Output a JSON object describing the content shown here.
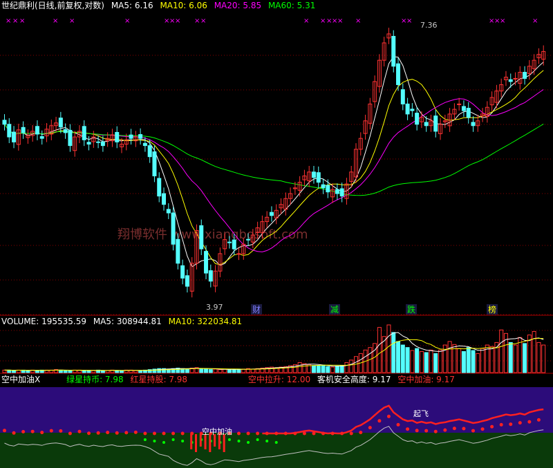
{
  "header": {
    "title": "世纪鼎利(日线,前复权,对数)",
    "ma5": "MA5: 6.16",
    "ma10": "MA10: 6.06",
    "ma20": "MA20: 5.85",
    "ma60": "MA60: 5.31"
  },
  "volume_header": {
    "label": "VOLUME: 195535.59",
    "ma5": "MA5: 308944.81",
    "ma10": "MA10: 322034.81"
  },
  "indicator_header": {
    "name": "空中加油X",
    "green": "绿星持币: 7.98",
    "red": "红星持股: 7.98",
    "pull": "空中拉升: 12.00",
    "safety": "客机安全高度: 9.17",
    "fuel": "空中加油: 9.17"
  },
  "annotations": {
    "high_label": "7.36",
    "low_label": "3.97",
    "badges": [
      "财",
      "减",
      "跌",
      "榜"
    ],
    "watermark": "翔博软件 www.xiangbosoft.com",
    "ind_label_1": "空中加油",
    "ind_label_2": "起飞"
  },
  "colors": {
    "up": "#ff3232",
    "down": "#54ffff",
    "ma5": "#ffffff",
    "ma10": "#ffff00",
    "ma20": "#ff00ff",
    "ma60": "#00ff00",
    "grid": "#8b0000",
    "ind_sky": "#2c0c7a",
    "ind_ground": "#0a3a0a"
  },
  "chart_data": {
    "type": "candlestick",
    "ylim_log": [
      3.8,
      7.6
    ],
    "closes": [
      5.9,
      5.72,
      5.65,
      5.82,
      5.78,
      5.74,
      5.8,
      5.76,
      5.7,
      5.83,
      5.88,
      5.92,
      5.86,
      5.78,
      5.6,
      5.72,
      5.8,
      5.68,
      5.62,
      5.72,
      5.65,
      5.6,
      5.7,
      5.75,
      5.65,
      5.62,
      5.68,
      5.7,
      5.72,
      5.7,
      5.6,
      5.45,
      5.2,
      4.95,
      4.85,
      4.75,
      4.4,
      4.2,
      4.05,
      3.97,
      4.2,
      4.55,
      4.35,
      4.1,
      4.02,
      4.12,
      4.3,
      4.45,
      4.42,
      4.35,
      4.3,
      4.4,
      4.45,
      4.5,
      4.58,
      4.65,
      4.7,
      4.72,
      4.78,
      4.85,
      4.92,
      4.98,
      5.05,
      5.12,
      5.2,
      5.25,
      5.18,
      5.12,
      5.05,
      5.0,
      5.03,
      4.98,
      4.95,
      5.1,
      5.25,
      5.55,
      5.7,
      5.95,
      6.2,
      6.55,
      6.9,
      7.2,
      7.36,
      6.8,
      6.5,
      6.2,
      6.05,
      6.1,
      5.9,
      6.0,
      5.88,
      5.95,
      5.8,
      5.9,
      5.95,
      6.05,
      6.12,
      6.2,
      6.1,
      6.0,
      5.88,
      5.95,
      6.05,
      6.15,
      6.3,
      6.4,
      6.5,
      6.62,
      6.55,
      6.6,
      6.7,
      6.6,
      6.8,
      6.9,
      7.0,
      7.05
    ],
    "volumes": [
      0.05,
      0.05,
      0.04,
      0.05,
      0.05,
      0.04,
      0.05,
      0.04,
      0.05,
      0.05,
      0.05,
      0.06,
      0.05,
      0.04,
      0.04,
      0.05,
      0.05,
      0.04,
      0.04,
      0.04,
      0.05,
      0.04,
      0.04,
      0.05,
      0.04,
      0.04,
      0.05,
      0.05,
      0.04,
      0.04,
      0.05,
      0.06,
      0.07,
      0.08,
      0.08,
      0.07,
      0.08,
      0.09,
      0.08,
      0.07,
      0.09,
      0.1,
      0.08,
      0.07,
      0.06,
      0.07,
      0.06,
      0.07,
      0.06,
      0.06,
      0.07,
      0.07,
      0.08,
      0.07,
      0.08,
      0.09,
      0.1,
      0.11,
      0.1,
      0.11,
      0.12,
      0.14,
      0.16,
      0.2,
      0.18,
      0.16,
      0.14,
      0.13,
      0.15,
      0.12,
      0.11,
      0.13,
      0.14,
      0.2,
      0.25,
      0.32,
      0.38,
      0.45,
      0.5,
      0.58,
      0.9,
      0.72,
      0.95,
      0.8,
      0.62,
      0.55,
      0.5,
      0.44,
      0.48,
      0.42,
      0.4,
      0.45,
      0.38,
      0.45,
      0.55,
      0.62,
      0.56,
      0.48,
      0.42,
      0.5,
      0.44,
      0.38,
      0.48,
      0.55,
      0.52,
      0.6,
      0.85,
      0.78,
      0.6,
      0.55,
      0.7,
      0.58,
      0.75,
      0.82,
      0.6,
      0.55
    ]
  }
}
